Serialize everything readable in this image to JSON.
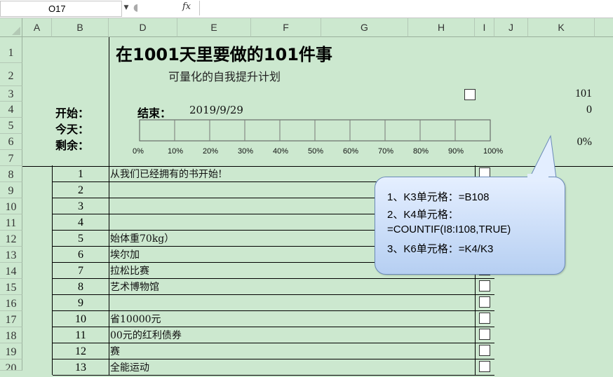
{
  "formula_bar": {
    "name_box": "O17",
    "fx_label": "fx",
    "formula": ""
  },
  "columns": [
    "A",
    "B",
    "D",
    "E",
    "F",
    "G",
    "H",
    "I",
    "J",
    "K"
  ],
  "rows": [
    "1",
    "2",
    "3",
    "4",
    "5",
    "6",
    "7",
    "8",
    "9",
    "10",
    "11",
    "12",
    "13",
    "14",
    "15",
    "16",
    "17",
    "18",
    "19",
    "20"
  ],
  "sheet": {
    "title": "在1001天里要做的101件事",
    "subtitle": "可量化的自我提升计划",
    "start_label": "开始：",
    "end_label": "结束：",
    "end_date": "2019/9/29",
    "today_label": "今天：",
    "remaining_label": "剩余：",
    "k3": "101",
    "k4": "0",
    "k6": "0%"
  },
  "progress": {
    "ticks": [
      "0%",
      "10%",
      "20%",
      "30%",
      "40%",
      "50%",
      "60%",
      "70%",
      "80%",
      "90%",
      "100%"
    ],
    "value": 0
  },
  "list": [
    {
      "num": "1",
      "text": "从我们已经拥有的书开始!"
    },
    {
      "num": "2",
      "text": ""
    },
    {
      "num": "3",
      "text": ""
    },
    {
      "num": "4",
      "text": ""
    },
    {
      "num": "5",
      "text": "始体重70kg）"
    },
    {
      "num": "6",
      "text": "埃尔加"
    },
    {
      "num": "7",
      "text": "拉松比赛"
    },
    {
      "num": "8",
      "text": "艺术博物馆"
    },
    {
      "num": "9",
      "text": ""
    },
    {
      "num": "10",
      "text": "省10000元"
    },
    {
      "num": "11",
      "text": "00元的红利债券"
    },
    {
      "num": "12",
      "text": "赛"
    },
    {
      "num": "13",
      "text": "全能运动"
    }
  ],
  "callout": {
    "line1": "1、K3单元格：=B108",
    "line2": "2、K4单元格：",
    "line3": "=COUNTIF(I8:I108,TRUE)",
    "line4": "3、K6单元格：=K4/K3"
  }
}
